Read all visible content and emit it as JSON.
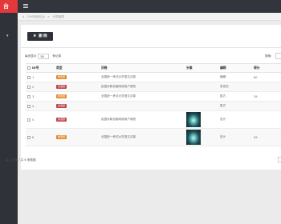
{
  "nav": {
    "brand": "台",
    "toggle_icon": "chevron-down-icon"
  },
  "topbar": {
    "menu_icon": "menu-icon"
  },
  "breadcrumb": {
    "home_icon": "home-icon",
    "root": "CMS系统后台",
    "separator": ">",
    "current": "分类管理"
  },
  "toolbar": {
    "delete_label": "删 除",
    "delete_icon": "close-icon"
  },
  "table_controls": {
    "length_prefix": "每页显示",
    "length_value": "50",
    "length_suffix": "条记录",
    "search_label": "搜索:"
  },
  "table": {
    "headers": [
      "ID号",
      "类型",
      "问卷",
      "头像",
      "编辑",
      "得分"
    ],
    "rows": [
      {
        "id": "1",
        "type": "单选题",
        "type_color": "#e8892b",
        "question": "全国统一考试大学语文试卷",
        "avatar": false,
        "editor": "编辑",
        "score": "60"
      },
      {
        "id": "2",
        "type": "多选题",
        "type_color": "#c0454a",
        "question": "民国对新创客网络用户调查",
        "avatar": false,
        "editor": "张伯安",
        "score": ""
      },
      {
        "id": "3",
        "type": "单选题",
        "type_color": "#e8892b",
        "question": "全国统一考试大学语文试卷",
        "avatar": false,
        "editor": "胜方",
        "score": "29"
      },
      {
        "id": "4",
        "type": "多选题",
        "type_color": "#c0454a",
        "question": "",
        "avatar": false,
        "editor": "胜方",
        "score": ""
      },
      {
        "id": "5",
        "type": "多选题",
        "type_color": "#c0454a",
        "question": "民国对新创客网络用户调查",
        "avatar": true,
        "editor": "查沙",
        "score": ""
      },
      {
        "id": "6",
        "type": "单选题",
        "type_color": "#e8892b",
        "question": "全国统一考试大学语文试卷",
        "avatar": true,
        "editor": "查沙",
        "score": "99"
      }
    ]
  },
  "footer": {
    "info": "从 1 到 6 / 共 6 条数据"
  }
}
